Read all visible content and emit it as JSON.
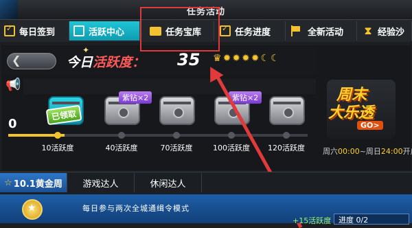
{
  "window": {
    "title": "任务活动"
  },
  "tabs": [
    {
      "label": "每日签到",
      "icon": "calendar-check-icon"
    },
    {
      "label": "活跃中心",
      "icon": "calendar-icon",
      "active": true
    },
    {
      "label": "任务宝库",
      "icon": "folder-icon"
    },
    {
      "label": "任务进度",
      "icon": "calendar-clock-icon"
    },
    {
      "label": "全新活动",
      "icon": "flag-icon"
    },
    {
      "label": "经验沙",
      "icon": "hourglass-icon"
    }
  ],
  "activity": {
    "today_label": "今日",
    "hot_label": "活跃度：",
    "value": "35"
  },
  "progress": {
    "start_value": "0",
    "milestones": [
      {
        "label": "10活跃度",
        "state": "claimed",
        "badge": "已领取"
      },
      {
        "label": "40活跃度",
        "state": "locked",
        "badge": "紫钻×2"
      },
      {
        "label": "70活跃度",
        "state": "locked",
        "badge": ""
      },
      {
        "label": "100活跃度",
        "state": "locked",
        "badge": "紫钻×2"
      },
      {
        "label": "120活跃度",
        "state": "locked",
        "badge": ""
      }
    ],
    "filled_fraction": 0.19
  },
  "promo": {
    "line1": "周末",
    "line2": "大乐透",
    "go": "GO>",
    "time_prefix": "周六",
    "time_start": "00:00",
    "time_mid": "~周日",
    "time_end": "24:00",
    "time_suffix": "开启"
  },
  "bottom_tabs": [
    {
      "label": "10.1黄金周",
      "active": true
    },
    {
      "label": "游戏达人"
    },
    {
      "label": "休闲达人"
    }
  ],
  "task": {
    "description": "每日参与两次全城通缉令模式",
    "reward": "+15活跃度",
    "progress": "进度 0/2"
  },
  "colors": {
    "accent": "#1ec5d7",
    "highlight": "#e03a3a",
    "gold": "#f2c230"
  }
}
